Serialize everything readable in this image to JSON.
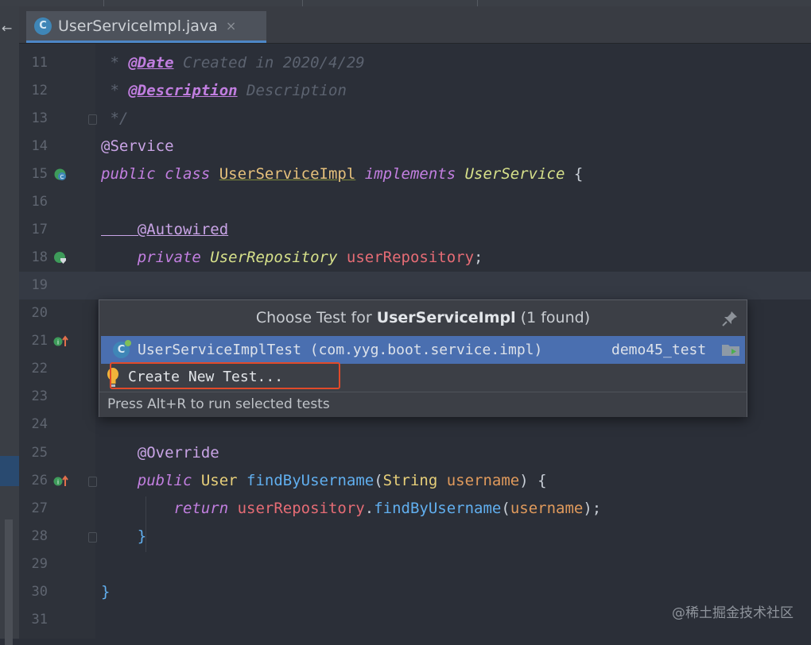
{
  "tab": {
    "label": "UserServiceImpl.java",
    "icon": "java-class-icon",
    "close_label": "×"
  },
  "editor": {
    "lines": [
      {
        "num": "11"
      },
      {
        "num": "12"
      },
      {
        "num": "13"
      },
      {
        "num": "14"
      },
      {
        "num": "15"
      },
      {
        "num": "16"
      },
      {
        "num": "17"
      },
      {
        "num": "18"
      },
      {
        "num": "19"
      },
      {
        "num": "20"
      },
      {
        "num": "21"
      },
      {
        "num": "22"
      },
      {
        "num": "23"
      },
      {
        "num": "24"
      },
      {
        "num": "25"
      },
      {
        "num": "26"
      },
      {
        "num": "27"
      },
      {
        "num": "28"
      },
      {
        "num": "29"
      },
      {
        "num": "30"
      },
      {
        "num": "31"
      }
    ],
    "code": {
      "l11_star": " * ",
      "l11_tag": "@Date",
      "l11_text": " Created in 2020/4/29",
      "l12_star": " * ",
      "l12_tag": "@Description",
      "l12_text": " Description",
      "l13": " */",
      "l14": "@Service",
      "l15_kw": "public class ",
      "l15_cls": "UserServiceImpl",
      "l15_impl": " implements ",
      "l15_iface": "UserService",
      "l15_brace": " {",
      "l17": "    @Autowired",
      "l18_kw": "    private ",
      "l18_type": "UserRepository",
      "l18_field": " userRepository",
      "l18_semi": ";",
      "l25": "    @Override",
      "l26_kw": "    public ",
      "l26_type": "User",
      "l26_method": " findByUsername",
      "l26_open": "(",
      "l26_ptype": "String",
      "l26_param": " username",
      "l26_close": ") {",
      "l27_kw": "        return ",
      "l27_field": "userRepository",
      "l27_dot": ".",
      "l27_method": "findByUsername",
      "l27_open": "(",
      "l27_param": "username",
      "l27_close": ");",
      "l28": "    }",
      "l30": "}"
    }
  },
  "popup": {
    "title_prefix": "Choose Test for ",
    "title_class": "UserServiceImpl",
    "title_suffix": " (1 found)",
    "result": {
      "name": "UserServiceImplTest (com.yyg.boot.service.impl)",
      "module": "demo45_test"
    },
    "create_label": "Create New Test...",
    "footer": "Press Alt+R to run selected tests"
  },
  "watermark": "@稀土掘金技术社区",
  "colors": {
    "highlight_border": "#e14a2a",
    "selection": "#4a6fb0",
    "background": "#2b2f38"
  }
}
